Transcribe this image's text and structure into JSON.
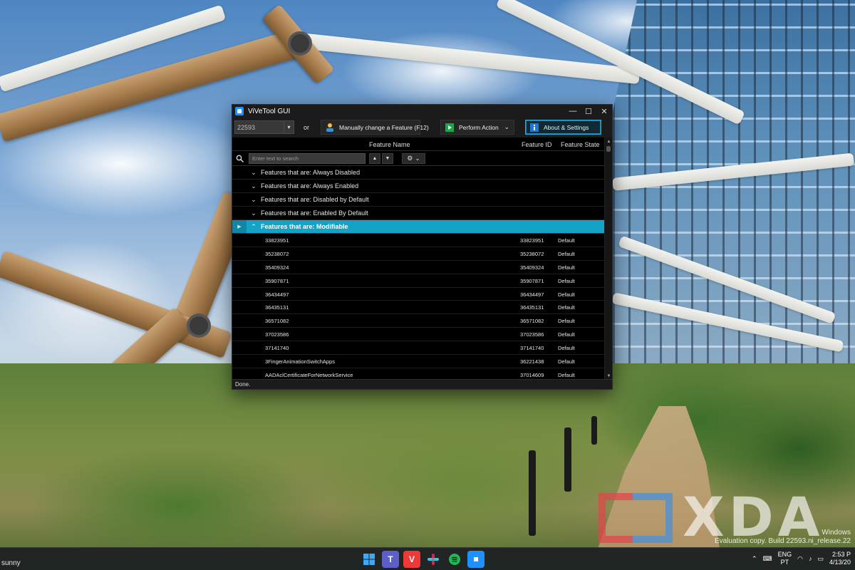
{
  "window": {
    "title": "ViVeTool GUI",
    "controls": {
      "minimize": "—",
      "maximize": "☐",
      "close": "✕"
    }
  },
  "toolbar": {
    "build_value": "22593",
    "or_label": "or",
    "manual_label": "Manually change a Feature (F12)",
    "perform_label": "Perform Action",
    "about_label": "About & Settings"
  },
  "grid": {
    "columns": {
      "name": "Feature Name",
      "id": "Feature ID",
      "state": "Feature State"
    },
    "search_placeholder": "Enter text to search",
    "groups": [
      {
        "label": "Features that are: Always Disabled"
      },
      {
        "label": "Features that are: Always Enabled"
      },
      {
        "label": "Features that are: Disabled by Default"
      },
      {
        "label": "Features that are: Enabled By Default"
      }
    ],
    "selected_group": {
      "label": "Features that are: Modifiable"
    },
    "rows": [
      {
        "name": "33823951",
        "id": "33823951",
        "state": "Default"
      },
      {
        "name": "35238072",
        "id": "35238072",
        "state": "Default"
      },
      {
        "name": "35409324",
        "id": "35409324",
        "state": "Default"
      },
      {
        "name": "35907871",
        "id": "35907871",
        "state": "Default"
      },
      {
        "name": "36434497",
        "id": "36434497",
        "state": "Default"
      },
      {
        "name": "36435131",
        "id": "36435131",
        "state": "Default"
      },
      {
        "name": "36571082",
        "id": "36571082",
        "state": "Default"
      },
      {
        "name": "37023586",
        "id": "37023586",
        "state": "Default"
      },
      {
        "name": "37141740",
        "id": "37141740",
        "state": "Default"
      },
      {
        "name": "3FingerAnimationSwitchApps",
        "id": "36221438",
        "state": "Default"
      },
      {
        "name": "AADAclCertificateForNetworkService",
        "id": "37014609",
        "state": "Default"
      }
    ]
  },
  "status": {
    "text": "Done."
  },
  "watermark": {
    "brand": "XDA",
    "windows_line1": "Windows",
    "windows_line2": "Evaluation copy. Build 22593.ni_release.22"
  },
  "taskbar": {
    "weather": "sunny",
    "lang_line1": "ENG",
    "lang_line2": "PT",
    "time": "2:53 P",
    "date": "4/13/20",
    "icons": [
      "windows-start-icon",
      "teams-icon",
      "vivaldi-icon",
      "slack-icon",
      "spotify-icon",
      "vivetool-taskbar-icon"
    ]
  },
  "colors": {
    "accent": "#14a3c7",
    "about_border": "#2aa9d9",
    "perform_icon": "#17a84a"
  }
}
